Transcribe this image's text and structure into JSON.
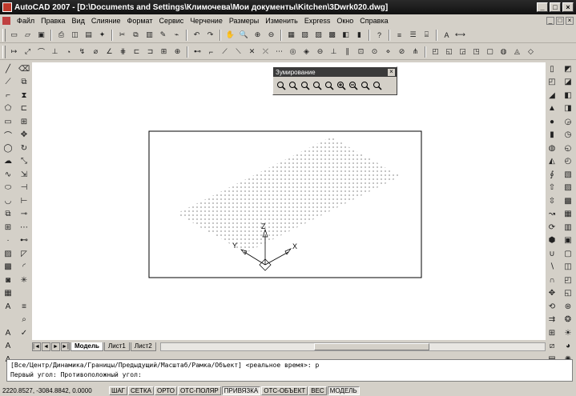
{
  "titlebar": {
    "title": "AutoCAD 2007 - [D:\\Documents and Settings\\Климочева\\Мои документы\\Kitchen\\3Dwrk020.dwg]",
    "minimize": "_",
    "maximize": "□",
    "close": "×"
  },
  "menu": {
    "items": [
      "Файл",
      "Правка",
      "Вид",
      "Слияние",
      "Формат",
      "Сервис",
      "Черчение",
      "Размеры",
      "Изменить",
      "Express",
      "Окно",
      "Справка"
    ]
  },
  "zoom_palette": {
    "title": "Зумирование",
    "close": "×"
  },
  "layout_tabs": {
    "nav": [
      "|◄",
      "◄",
      "►",
      "►|"
    ],
    "tabs": [
      "Модель",
      "Лист1",
      "Лист2"
    ],
    "active": "Модель"
  },
  "command_line": {
    "lines": [
      "[Все/Центр/Динамика/Границы/Предыдущий/Масштаб/Рамка/Объект] <реальное время>: p",
      "Первый угол: Противоположный угол:"
    ]
  },
  "status": {
    "coords": "2220.8527, -3084.8842, 0.0000",
    "buttons": [
      {
        "label": "ШАГ",
        "on": false
      },
      {
        "label": "СЕТКА",
        "on": false
      },
      {
        "label": "ОРТО",
        "on": false
      },
      {
        "label": "ОТС-ПОЛЯР",
        "on": false
      },
      {
        "label": "ПРИВЯЗКА",
        "on": true
      },
      {
        "label": "ОТС-ОБЪЕКТ",
        "on": false
      },
      {
        "label": "ВЕС",
        "on": false
      },
      {
        "label": "МОДЕЛЬ",
        "on": true
      }
    ]
  },
  "ucs": {
    "x": "X",
    "y": "Y",
    "z": "Z"
  },
  "colors": {
    "canvas": "#ffffff",
    "chrome": "#d4d0c8",
    "titlebar": "#1a1a1a"
  }
}
